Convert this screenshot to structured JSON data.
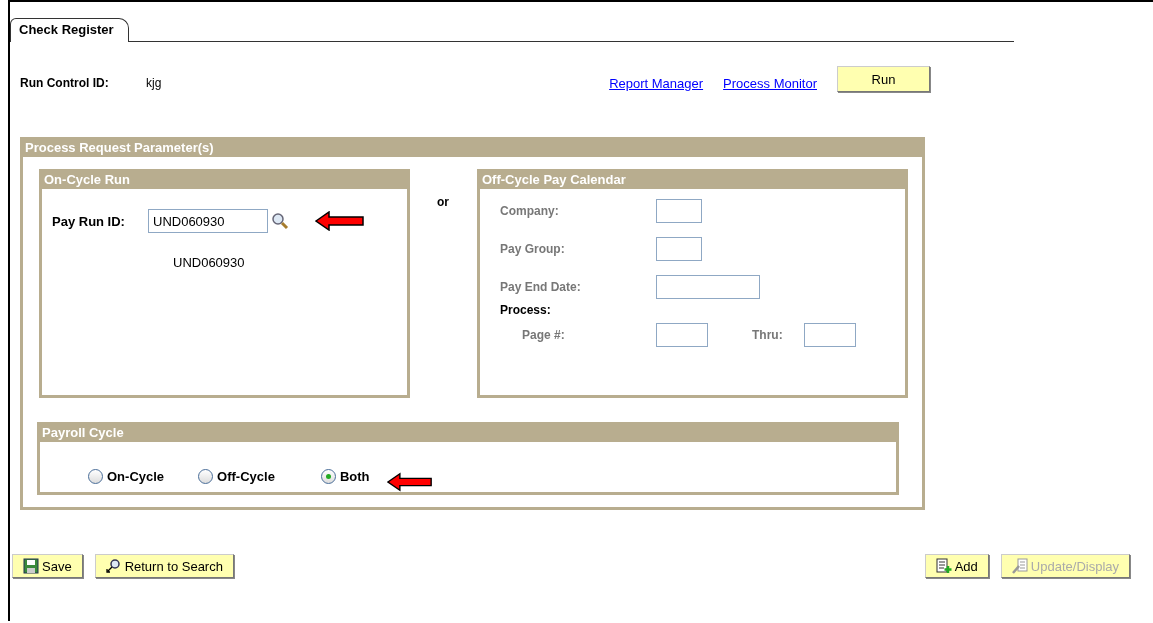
{
  "tabs": [
    {
      "label": "Check Register",
      "selected": true
    }
  ],
  "run_control": {
    "label": "Run Control ID:",
    "value": "kjg"
  },
  "links": [
    "Report Manager",
    "Process Monitor"
  ],
  "run_button": "Run",
  "parameters": {
    "title": "Process Request Parameter(s)",
    "on_cycle": {
      "title": "On-Cycle Run",
      "field_label": "Pay Run ID:",
      "value": "UND060930",
      "description": "UND060930",
      "annotated": true
    },
    "separator": "or",
    "off_cycle": {
      "title": "Off-Cycle Pay Calendar",
      "disabled": true,
      "fields": [
        {
          "label": "Company:",
          "kind": "code"
        },
        {
          "label": "Pay Group:",
          "kind": "code"
        },
        {
          "label": "Pay End Date:",
          "kind": "date"
        }
      ],
      "process_label": "Process:",
      "page_from": "Page #:",
      "page_thru": "Thru:"
    },
    "payroll_cycle": {
      "title": "Payroll Cycle",
      "options": [
        {
          "label": "On-Cycle",
          "selected": false,
          "annotated": false
        },
        {
          "label": "Off-Cycle",
          "selected": false,
          "annotated": false
        },
        {
          "label": "Both",
          "selected": true,
          "annotated": true
        }
      ]
    }
  },
  "footer": {
    "left": [
      {
        "kind": "save",
        "label": "Save",
        "disabled": false
      },
      {
        "kind": "search",
        "label": "Return to Search",
        "disabled": false
      }
    ],
    "right": [
      {
        "kind": "add",
        "label": "Add",
        "disabled": false
      },
      {
        "kind": "update",
        "label": "Update/Display",
        "disabled": true
      }
    ]
  }
}
